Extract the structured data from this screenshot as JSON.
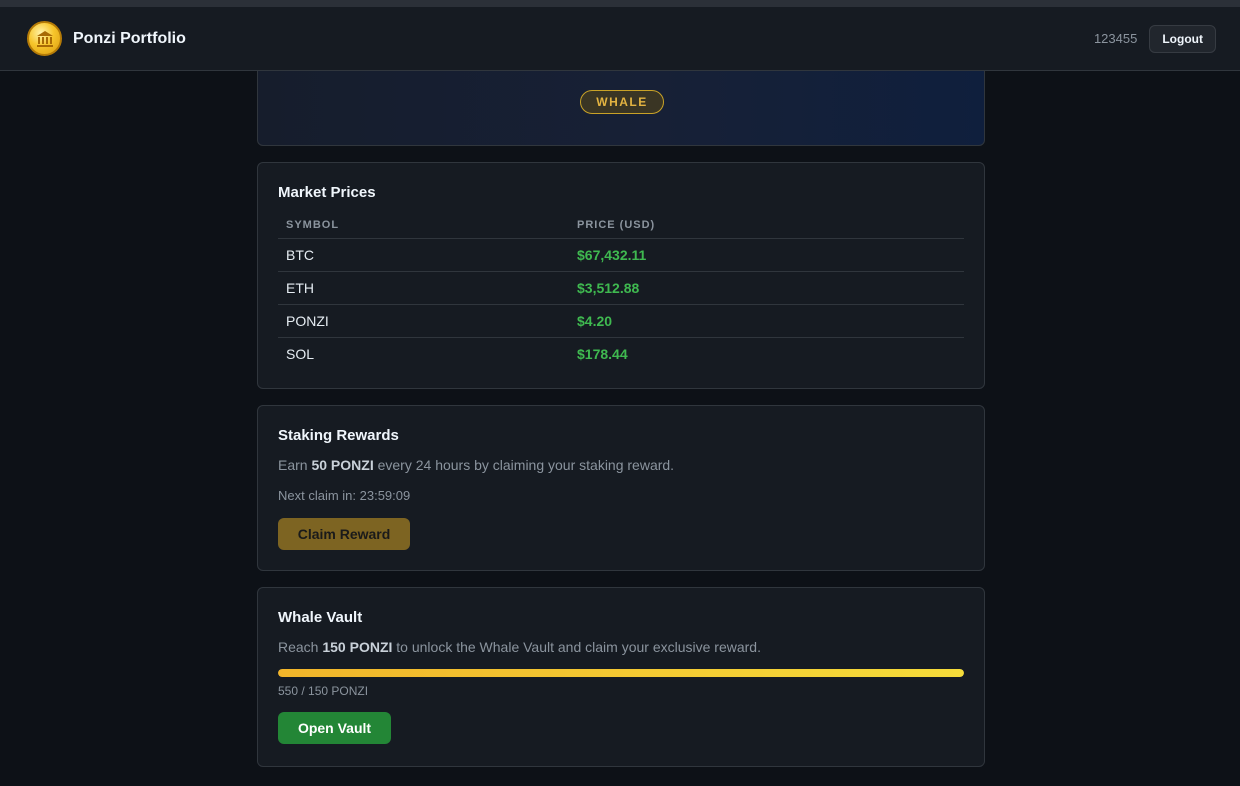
{
  "header": {
    "brand_title": "Ponzi Portfolio",
    "logo_icon": "bank-coin-icon",
    "username": "123455",
    "logout_label": "Logout"
  },
  "profile": {
    "tier_badge": "WHALE"
  },
  "market": {
    "title": "Market Prices",
    "columns": [
      "SYMBOL",
      "PRICE (USD)"
    ],
    "rows": [
      {
        "symbol": "BTC",
        "price": "$67,432.11"
      },
      {
        "symbol": "ETH",
        "price": "$3,512.88"
      },
      {
        "symbol": "PONZI",
        "price": "$4.20"
      },
      {
        "symbol": "SOL",
        "price": "$178.44"
      }
    ]
  },
  "staking": {
    "title": "Staking Rewards",
    "desc_prefix": "Earn ",
    "desc_amount": "50 PONZI",
    "desc_suffix": " every 24 hours by claiming your staking reward.",
    "next_claim": "Next claim in: 23:59:09",
    "claim_label": "Claim Reward"
  },
  "vault": {
    "title": "Whale Vault",
    "desc_prefix": "Reach ",
    "desc_amount": "150 PONZI",
    "desc_suffix": " to unlock the Whale Vault and claim your exclusive reward.",
    "progress_fraction": 1.0,
    "progress_label": "550 / 150 PONZI",
    "open_label": "Open Vault"
  },
  "colors": {
    "background": "#0d1117",
    "card": "#161b22",
    "price_green": "#3fb950",
    "badge_gold": "#e3b341",
    "open_green": "#238636"
  }
}
